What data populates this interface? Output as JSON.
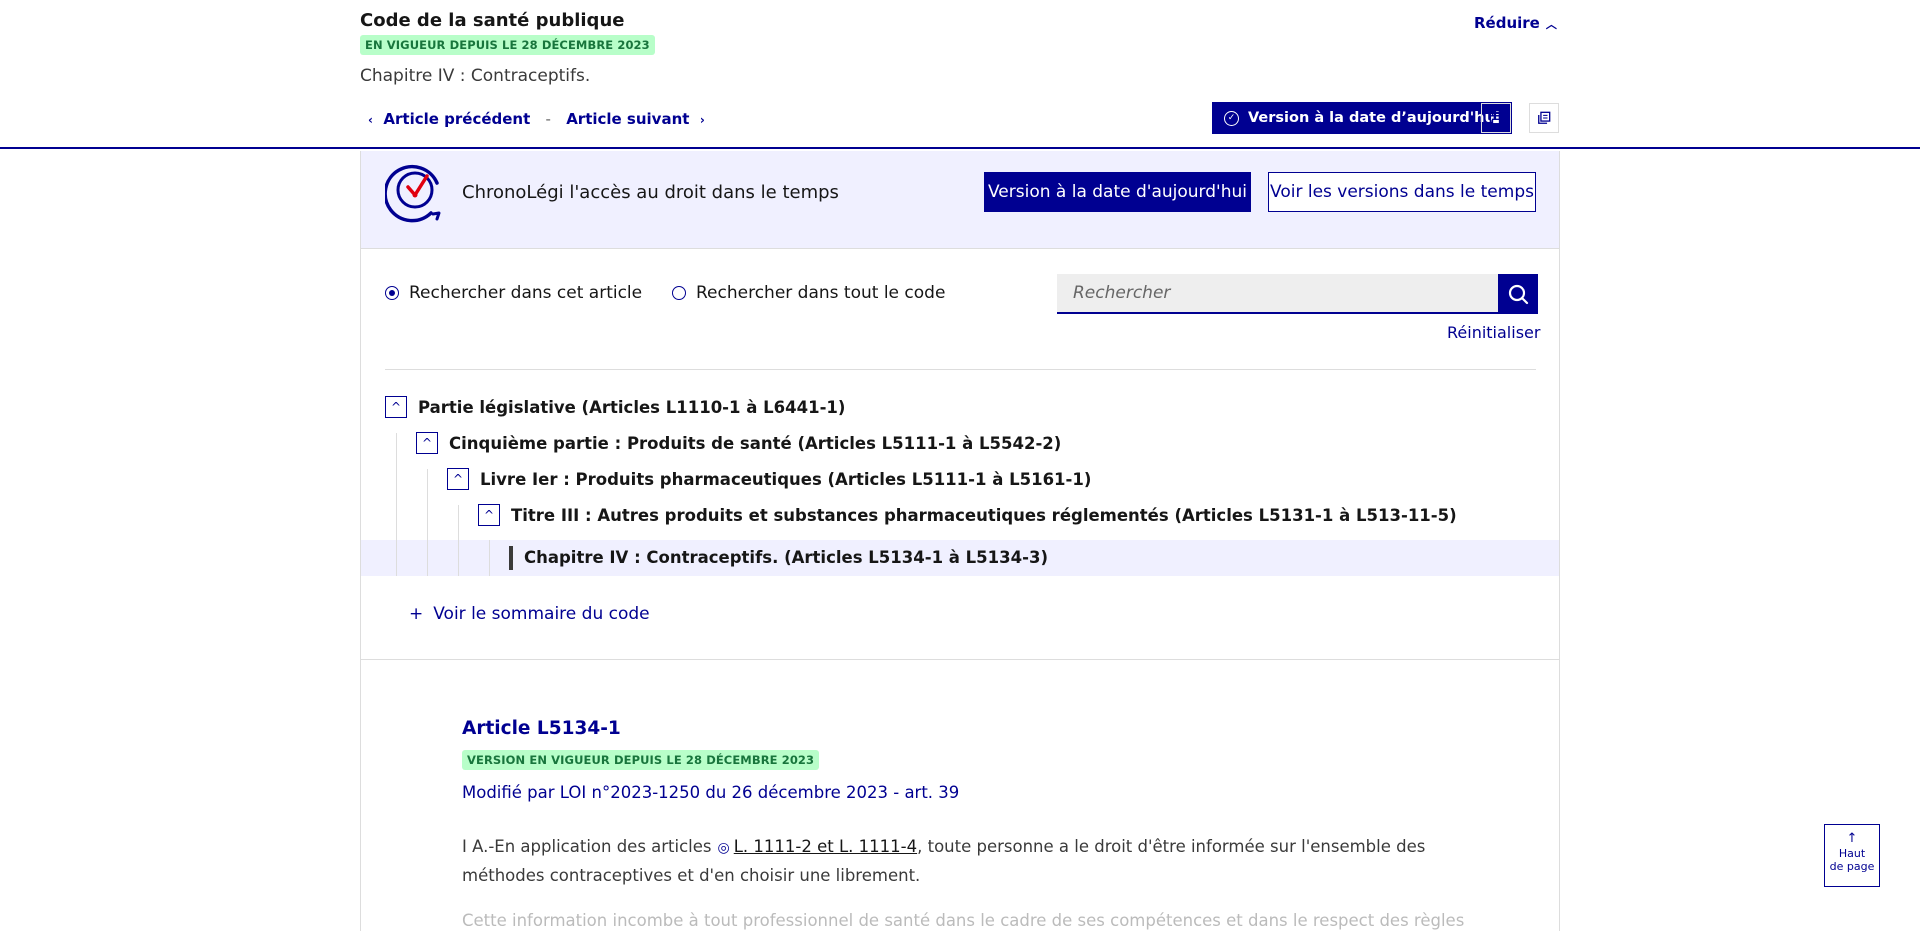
{
  "header": {
    "code_title": "Code de la santé publique",
    "status_badge": "EN VIGUEUR DEPUIS LE 28 DÉCEMBRE 2023",
    "chapter_subtitle": "Chapitre IV : Contraceptifs.",
    "reduce_label": "Réduire",
    "prev_article": "Article précédent",
    "separator": "-",
    "next_article": "Article suivant",
    "version_today_button": "Version à la date d’aujourd'hui"
  },
  "chronolegi": {
    "title": "ChronoLégi l'accès au droit dans le temps",
    "today_button": "Version à la date d'aujourd'hui",
    "versions_button": "Voir les versions dans le temps"
  },
  "search": {
    "scope_article": "Rechercher dans cet article",
    "scope_code": "Rechercher dans tout le code",
    "selected_scope": "article",
    "placeholder": "Rechercher",
    "value": "",
    "reset_label": "Réinitialiser"
  },
  "tree": {
    "items": [
      {
        "label": "Partie législative (Articles L1110-1 à L6441-1)"
      },
      {
        "label": "Cinquième partie : Produits de santé (Articles L5111-1 à L5542-2)"
      },
      {
        "label": "Livre Ier : Produits pharmaceutiques (Articles L5111-1 à L5161-1)"
      },
      {
        "label": "Titre III : Autres produits et substances pharmaceutiques réglementés (Articles L5131-1 à L513-11-5)"
      }
    ],
    "current": "Chapitre IV : Contraceptifs. (Articles L5134-1 à L5134-3)",
    "toggle_symbol": "^",
    "sommaire_label": "Voir le sommaire du code"
  },
  "article": {
    "title": "Article L5134-1",
    "badge": "VERSION EN VIGUEUR DEPUIS LE 28 DÉCEMBRE 2023",
    "modified_by": "Modifié par LOI n°2023-1250 du 26 décembre 2023 - art. 39",
    "text_before": "I A.-En application des articles",
    "text_ref": "L. 1111-2 et L. 1111-4",
    "text_after": ", toute personne a le droit d'être informée sur l'ensemble des méthodes contraceptives et d'en choisir une librement.",
    "text_next": "Cette information incombe à tout professionnel de santé dans le cadre de ses compétences et dans le respect des règles"
  },
  "back_to_top": {
    "line1": "Haut",
    "line2": "de page"
  },
  "colors": {
    "primary": "#000091",
    "badge_bg": "#b8fec9",
    "badge_text": "#18753c",
    "highlight_bg": "#f0f0ff",
    "accent_red": "#e1000f"
  }
}
